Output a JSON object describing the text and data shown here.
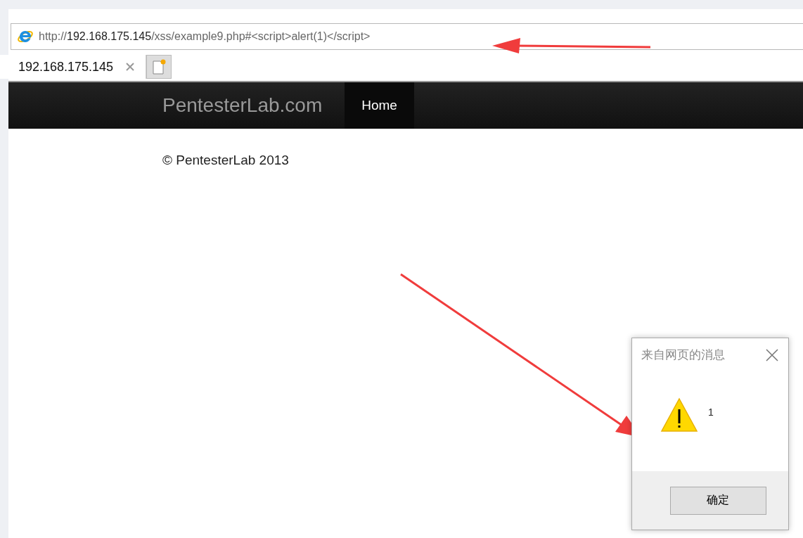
{
  "address_bar": {
    "scheme": "http://",
    "host": "192.168.175.145",
    "path": "/xss/example9.php#<script>alert(1)</script>"
  },
  "tabs": [
    {
      "label": "192.168.175.145",
      "selected": true
    }
  ],
  "navbar": {
    "brand": "PentesterLab.com",
    "items": [
      {
        "label": "Home",
        "selected": true
      }
    ]
  },
  "footer": "© PentesterLab 2013",
  "dialog": {
    "title": "来自网页的消息",
    "message": "1",
    "buttons": [
      "确定"
    ]
  }
}
